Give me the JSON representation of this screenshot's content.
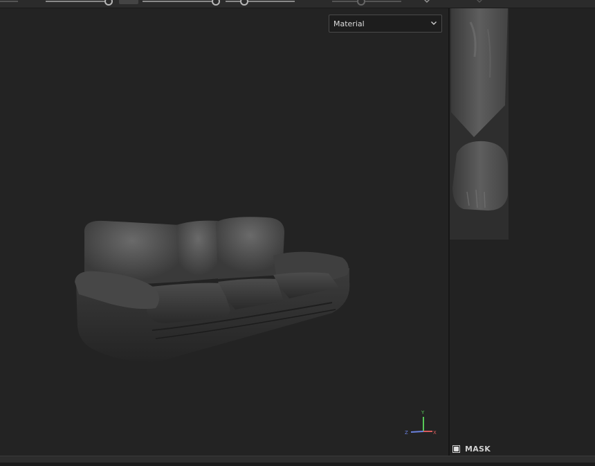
{
  "viewport": {
    "mode_select": {
      "selected": "Material"
    }
  },
  "gizmo": {
    "y_label": "Y",
    "x_label": "X",
    "z_label": "Z"
  },
  "uv_panel": {
    "mask_label": "MASK",
    "mask_checked": true
  },
  "colors": {
    "background": "#232323",
    "toolbar": "#2b2b2b",
    "axis_y": "#57c957",
    "axis_x": "#d85c5c",
    "axis_z": "#6b82e0"
  },
  "icons": [
    "chevron-down-icon",
    "checkbox-icon",
    "axis-gizmo-icon"
  ]
}
